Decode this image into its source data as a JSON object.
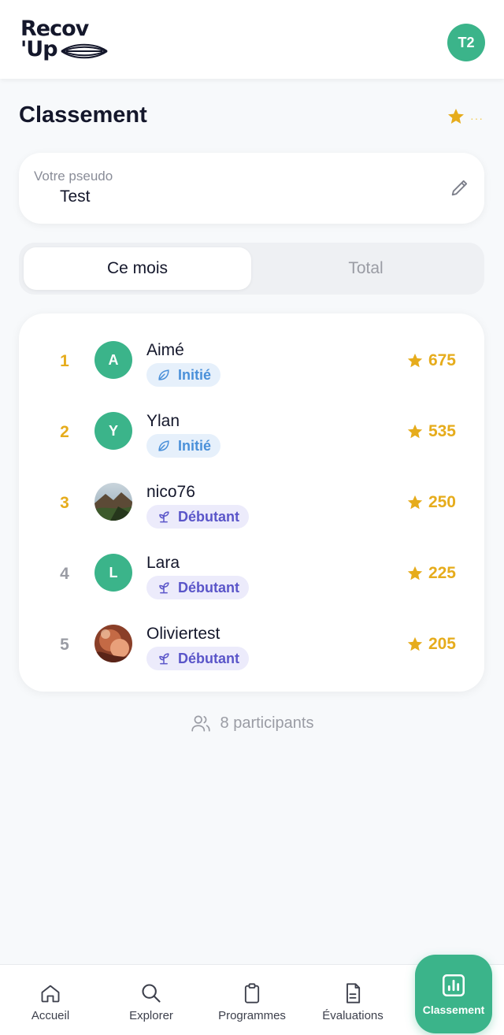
{
  "header": {
    "logo_line1": "Recov",
    "logo_line2": "'Up",
    "user_initials": "T2"
  },
  "page": {
    "title": "Classement",
    "title_dots": "···"
  },
  "pseudo": {
    "label": "Votre pseudo",
    "value": "Test"
  },
  "tabs": {
    "month": "Ce mois",
    "total": "Total",
    "active": "month"
  },
  "leaderboard": [
    {
      "rank": "1",
      "initial": "A",
      "name": "Aimé",
      "level": "Initié",
      "score": "675"
    },
    {
      "rank": "2",
      "initial": "Y",
      "name": "Ylan",
      "level": "Initié",
      "score": "535"
    },
    {
      "rank": "3",
      "initial": "",
      "name": "nico76",
      "level": "Débutant",
      "score": "250"
    },
    {
      "rank": "4",
      "initial": "L",
      "name": "Lara",
      "level": "Débutant",
      "score": "225"
    },
    {
      "rank": "5",
      "initial": "",
      "name": "Oliviertest",
      "level": "Débutant",
      "score": "205"
    }
  ],
  "participants": "8 participants",
  "nav": {
    "home": "Accueil",
    "explore": "Explorer",
    "programs": "Programmes",
    "evaluations": "Évaluations",
    "ranking": "Classement"
  },
  "colors": {
    "brand_green": "#3bb48a",
    "gold": "#e6ac1c",
    "rank_gray": "#9a9ca4",
    "initie_blue": "#4a90d9",
    "debutant_purple": "#5a55c9"
  }
}
